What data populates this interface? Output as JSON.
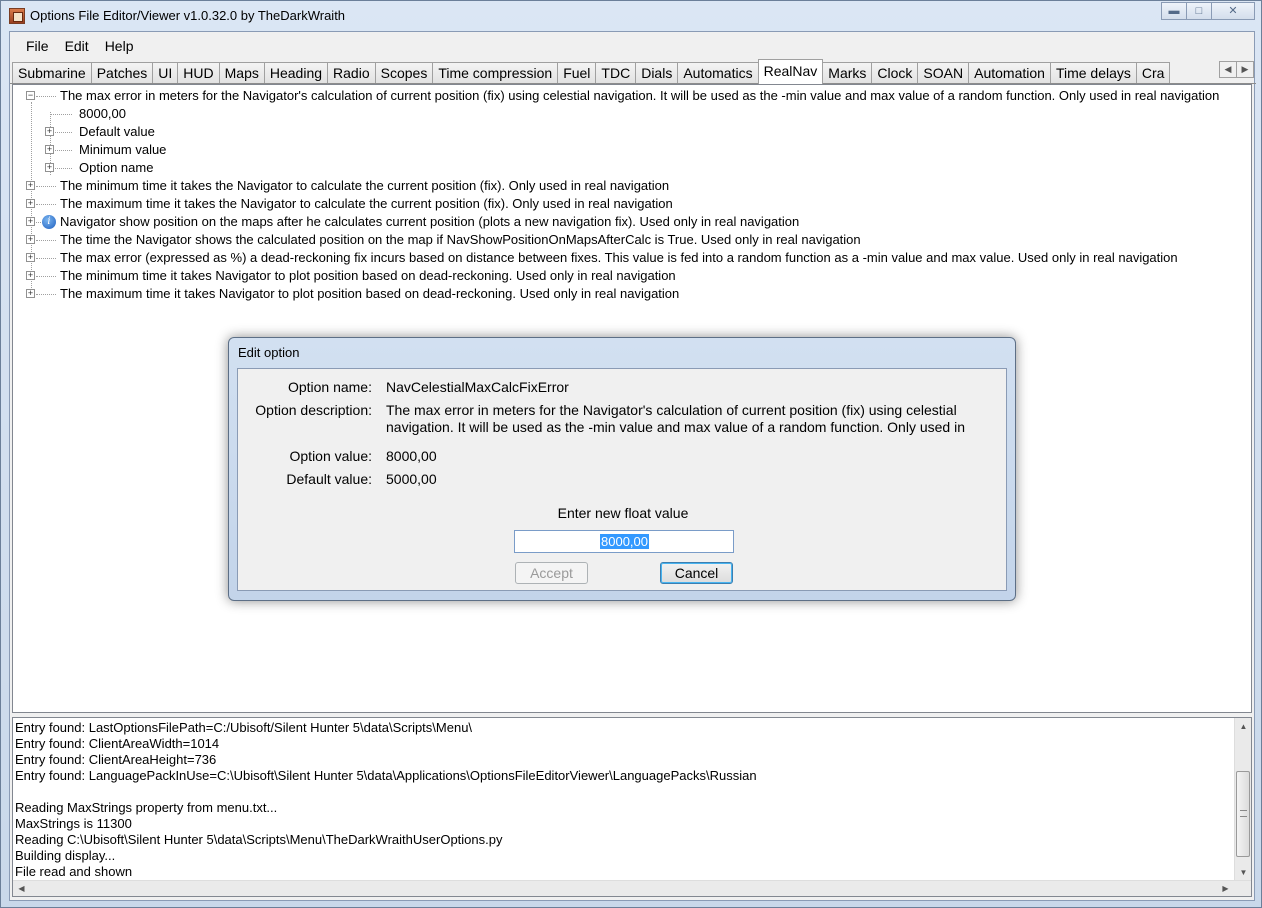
{
  "window": {
    "title": "Options File Editor/Viewer v1.0.32.0 by TheDarkWraith",
    "caption_buttons": [
      "minimize",
      "maximize",
      "close"
    ]
  },
  "menu": [
    "File",
    "Edit",
    "Help"
  ],
  "tabs": [
    "Submarine",
    "Patches",
    "UI",
    "HUD",
    "Maps",
    "Heading",
    "Radio",
    "Scopes",
    "Time compression",
    "Fuel",
    "TDC",
    "Dials",
    "Automatics",
    "RealNav",
    "Marks",
    "Clock",
    "SOAN",
    "Automation",
    "Time delays",
    "Cra"
  ],
  "active_tab": "RealNav",
  "tree": {
    "expanded_item": {
      "text": "The max error in meters for the Navigator's calculation of current position (fix) using celestial navigation. It will be used as the -min value and max value of a random function. Only used in real navigation",
      "value": "8000,00",
      "children": [
        "Default value",
        "Minimum value",
        "Option name"
      ]
    },
    "items": [
      "The minimum time it takes the Navigator to calculate the current position (fix). Only used in real navigation",
      "The maximum time it takes the Navigator to calculate the current position (fix). Only used in real navigation",
      "Navigator show position on the maps after he calculates current position (plots a new navigation fix). Used only in real navigation",
      "The time the Navigator shows the calculated position on the map if NavShowPositionOnMapsAfterCalc is True. Used only in real navigation",
      "The max error (expressed as %) a dead-reckoning fix incurs based on distance between fixes. This value is fed into a random function as a -min value and max value. Used only in real navigation",
      "The minimum time it takes Navigator to plot position based on dead-reckoning. Used only in real navigation",
      "The maximum time it takes Navigator to plot position based on dead-reckoning. Used only in real navigation"
    ]
  },
  "dialog": {
    "title": "Edit option",
    "option_name_label": "Option name:",
    "option_name": "NavCelestialMaxCalcFixError",
    "option_description_label": "Option description:",
    "option_description": "The max error in meters for the Navigator's calculation of current position (fix) using celestial navigation. It will be used as the -min value and max value of a random function. Only used in",
    "option_value_label": "Option value:",
    "option_value": "8000,00",
    "default_value_label": "Default value:",
    "default_value": "5000,00",
    "enter_label": "Enter new float value",
    "input_value": "8000,00",
    "accept_label": "Accept",
    "cancel_label": "Cancel"
  },
  "log": [
    "Entry found: LastOptionsFilePath=C:/Ubisoft/Silent Hunter 5\\data\\Scripts\\Menu\\",
    "Entry found: ClientAreaWidth=1014",
    "Entry found: ClientAreaHeight=736",
    "Entry found: LanguagePackInUse=C:\\Ubisoft\\Silent Hunter 5\\data\\Applications\\OptionsFileEditorViewer\\LanguagePacks\\Russian",
    "",
    "Reading MaxStrings property from menu.txt...",
    "MaxStrings is 11300",
    "Reading C:\\Ubisoft\\Silent Hunter 5\\data\\Scripts\\Menu\\TheDarkWraithUserOptions.py",
    "Building display...",
    "File read and shown"
  ]
}
